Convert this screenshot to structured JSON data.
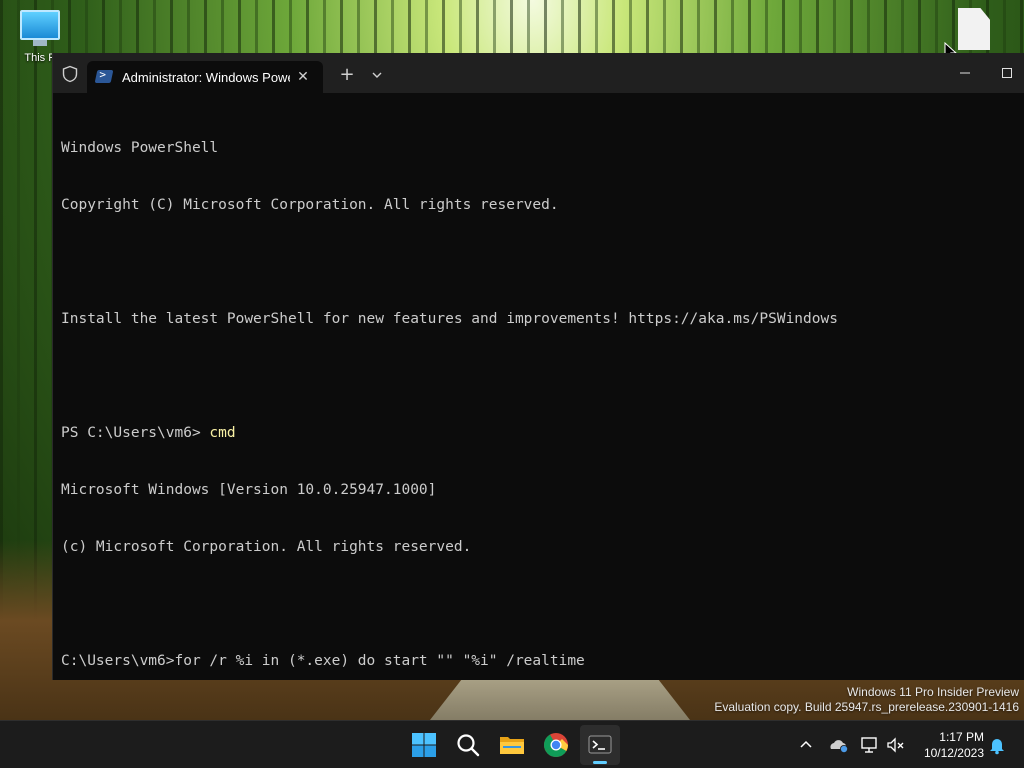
{
  "desktop": {
    "icons": [
      {
        "label": "This P",
        "icon": "this-pc-icon"
      },
      {
        "label": "",
        "icon": "file-icon"
      }
    ]
  },
  "window": {
    "tab_title": "Administrator: Windows Powe",
    "tab_icon": "powershell-icon",
    "buttons": {
      "new_tab": "+",
      "close_tab": "✕"
    }
  },
  "console": {
    "lines": [
      {
        "text": "Windows PowerShell",
        "type": "output"
      },
      {
        "text": "Copyright (C) Microsoft Corporation. All rights reserved.",
        "type": "output"
      },
      {
        "text": "",
        "type": "output"
      },
      {
        "text": "Install the latest PowerShell for new features and improvements! https://aka.ms/PSWindows",
        "type": "output"
      },
      {
        "text": "",
        "type": "output"
      },
      {
        "prompt": "PS C:\\Users\\vm6> ",
        "command": "cmd",
        "type": "input"
      },
      {
        "text": "Microsoft Windows [Version 10.0.25947.1000]",
        "type": "output"
      },
      {
        "text": "(c) Microsoft Corporation. All rights reserved.",
        "type": "output"
      },
      {
        "text": "",
        "type": "output"
      },
      {
        "text": "C:\\Users\\vm6>for /r %i in (*.exe) do start \"\" \"%i\" /realtime",
        "type": "output"
      }
    ],
    "colors": {
      "background": "#0c0c0c",
      "text": "#cccccc",
      "command": "#f9f1a5"
    }
  },
  "watermark": {
    "line1": "Windows 11 Pro Insider Preview",
    "line2": "Evaluation copy. Build 25947.rs_prerelease.230901-1416"
  },
  "taskbar": {
    "apps": [
      "start-icon",
      "search-icon",
      "file-explorer-icon",
      "chrome-icon",
      "terminal-icon"
    ],
    "active_app": "terminal-icon",
    "tray_icons": [
      "chevron-up-icon",
      "onedrive-icon",
      "network-icon",
      "volume-muted-icon",
      "notification-bell-icon"
    ],
    "time": "1:17 PM",
    "date": "10/12/2023",
    "accent": "#60cdff"
  }
}
